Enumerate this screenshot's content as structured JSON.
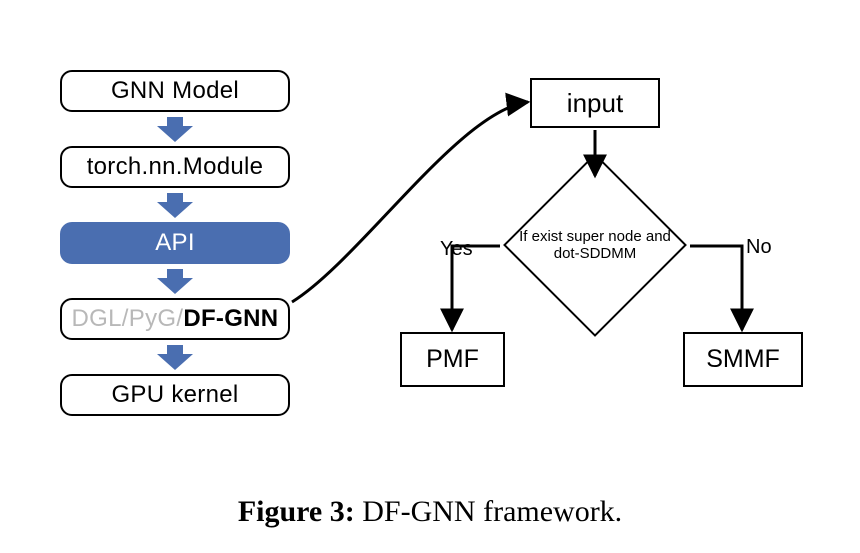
{
  "stack": {
    "gnn_model": "GNN Model",
    "torch_module": "torch.nn.Module",
    "api": "API",
    "backends_grey": "DGL/PyG/",
    "backends_bold": "DF-GNN",
    "gpu_kernel": "GPU kernel"
  },
  "flow": {
    "input": "input",
    "decision": "If exist super node and dot-SDDMM",
    "yes_label": "Yes",
    "no_label": "No",
    "yes_result": "PMF",
    "no_result": "SMMF"
  },
  "caption": {
    "figure_label": "Figure 3:",
    "figure_text": " DF-GNN framework."
  },
  "colors": {
    "accent_blue": "#4a6eb0",
    "grey_text": "#b8b8b8"
  }
}
